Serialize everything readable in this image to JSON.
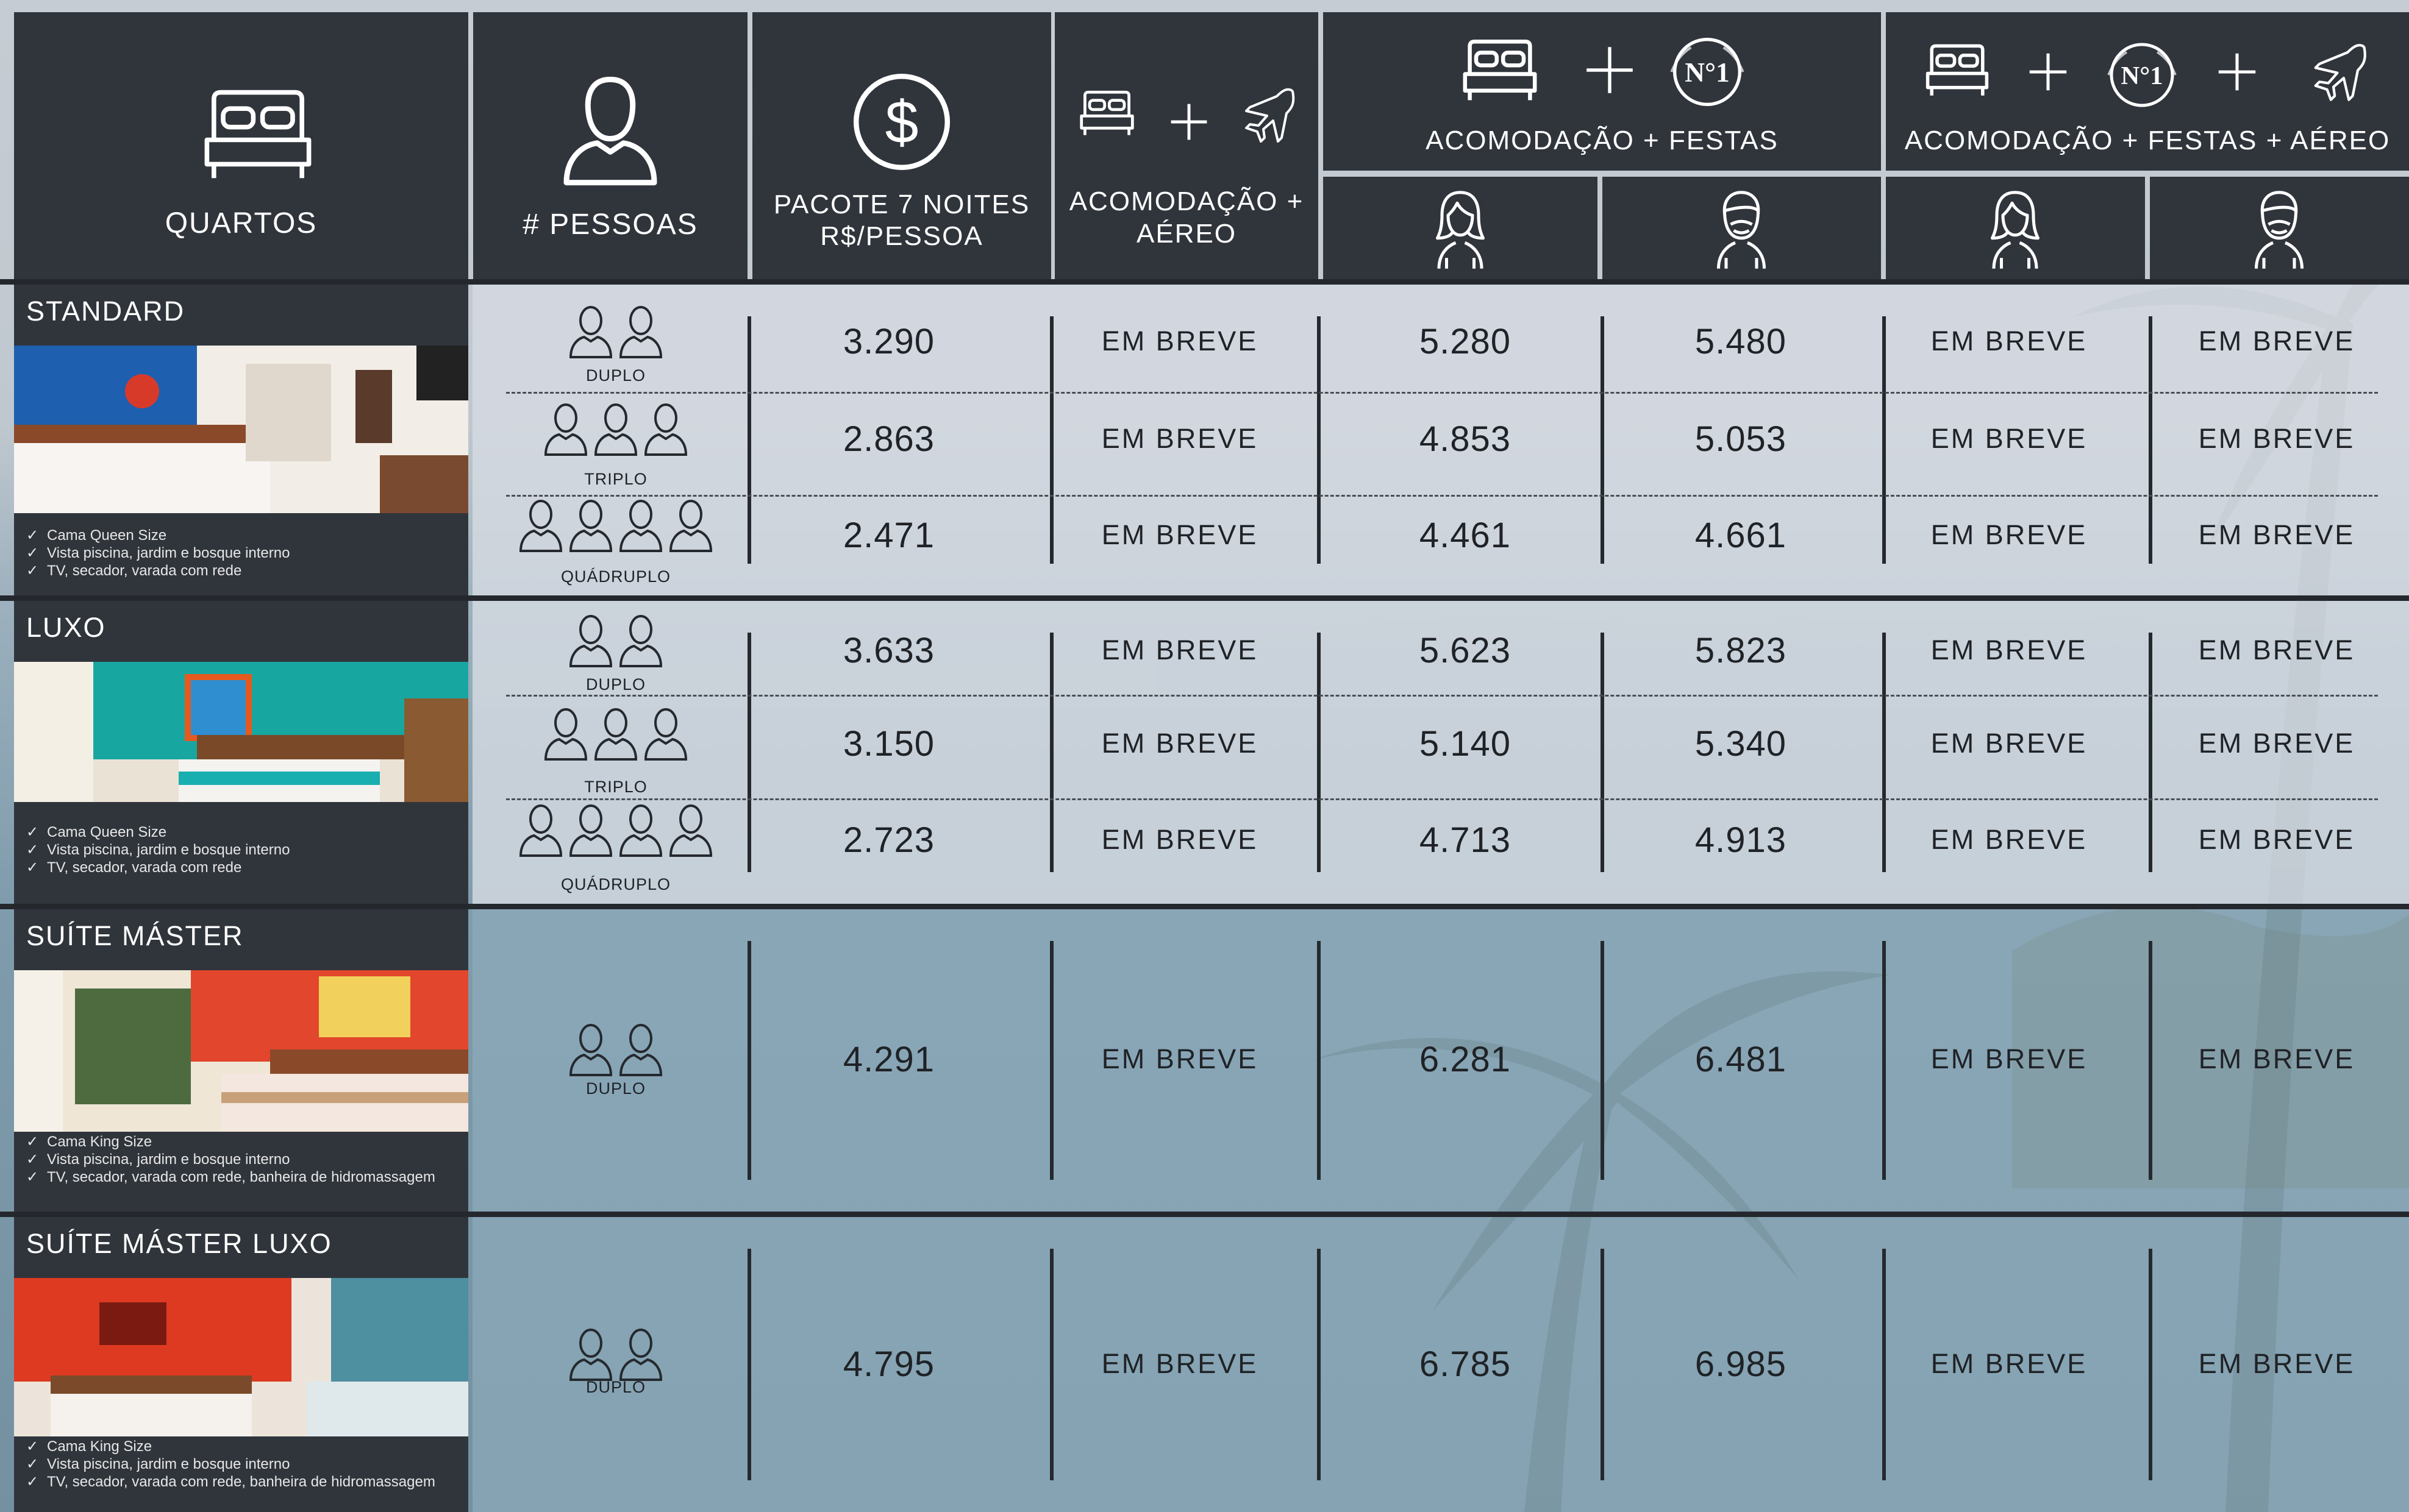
{
  "header": {
    "rooms": "QUARTOS",
    "people": "# PESSOAS",
    "package_line1": "PACOTE 7 NOITES",
    "package_line2": "R$/PESSOA",
    "acc_air_line1": "ACOMODAÇÃO +",
    "acc_air_line2": "AÉREO",
    "acc_parties": "ACOMODAÇÃO + FESTAS",
    "acc_parties_air": "ACOMODAÇÃO + FESTAS + AÉREO",
    "logo_text": "N°1",
    "icons": [
      "bed-icon",
      "person-icon",
      "dollar-icon",
      "plane-icon",
      "plus-icon",
      "logo-badge",
      "woman-icon",
      "man-icon"
    ]
  },
  "rooms": [
    {
      "name": "STANDARD",
      "features": [
        "Cama Queen Size",
        "Vista piscina, jardim e bosque interno",
        "TV, secador, varada com rede"
      ],
      "rows": [
        {
          "occupancy": "DUPLO",
          "persons": 2,
          "package": "3.290",
          "acc_air": "EM BREVE",
          "parties_f": "5.280",
          "parties_m": "5.480",
          "parties_air_f": "EM BREVE",
          "parties_air_m": "EM BREVE"
        },
        {
          "occupancy": "TRIPLO",
          "persons": 3,
          "package": "2.863",
          "acc_air": "EM BREVE",
          "parties_f": "4.853",
          "parties_m": "5.053",
          "parties_air_f": "EM BREVE",
          "parties_air_m": "EM BREVE"
        },
        {
          "occupancy": "QUÁDRUPLO",
          "persons": 4,
          "package": "2.471",
          "acc_air": "EM BREVE",
          "parties_f": "4.461",
          "parties_m": "4.661",
          "parties_air_f": "EM BREVE",
          "parties_air_m": "EM BREVE"
        }
      ]
    },
    {
      "name": "LUXO",
      "features": [
        "Cama Queen Size",
        "Vista piscina, jardim e bosque interno",
        "TV, secador, varada com rede"
      ],
      "rows": [
        {
          "occupancy": "DUPLO",
          "persons": 2,
          "package": "3.633",
          "acc_air": "EM BREVE",
          "parties_f": "5.623",
          "parties_m": "5.823",
          "parties_air_f": "EM BREVE",
          "parties_air_m": "EM BREVE"
        },
        {
          "occupancy": "TRIPLO",
          "persons": 3,
          "package": "3.150",
          "acc_air": "EM BREVE",
          "parties_f": "5.140",
          "parties_m": "5.340",
          "parties_air_f": "EM BREVE",
          "parties_air_m": "EM BREVE"
        },
        {
          "occupancy": "QUÁDRUPLO",
          "persons": 4,
          "package": "2.723",
          "acc_air": "EM BREVE",
          "parties_f": "4.713",
          "parties_m": "4.913",
          "parties_air_f": "EM BREVE",
          "parties_air_m": "EM BREVE"
        }
      ]
    },
    {
      "name": "SUÍTE MÁSTER",
      "features": [
        "Cama King Size",
        "Vista piscina, jardim e bosque interno",
        "TV, secador, varada com rede, banheira de hidromassagem"
      ],
      "rows": [
        {
          "occupancy": "DUPLO",
          "persons": 2,
          "package": "4.291",
          "acc_air": "EM BREVE",
          "parties_f": "6.281",
          "parties_m": "6.481",
          "parties_air_f": "EM BREVE",
          "parties_air_m": "EM BREVE"
        }
      ]
    },
    {
      "name": "SUÍTE MÁSTER LUXO",
      "features": [
        "Cama King Size",
        "Vista piscina, jardim e bosque interno",
        "TV, secador, varada com rede, banheira de hidromassagem"
      ],
      "rows": [
        {
          "occupancy": "DUPLO",
          "persons": 2,
          "package": "4.795",
          "acc_air": "EM BREVE",
          "parties_f": "6.785",
          "parties_m": "6.985",
          "parties_air_f": "EM BREVE",
          "parties_air_m": "EM BREVE"
        }
      ]
    }
  ],
  "colors": {
    "header_bg": "#30353c",
    "text_dark": "#1f2226",
    "band_top": "#c9cfd6",
    "band_bottom": "#7d96a6",
    "separator": "#24282d"
  }
}
